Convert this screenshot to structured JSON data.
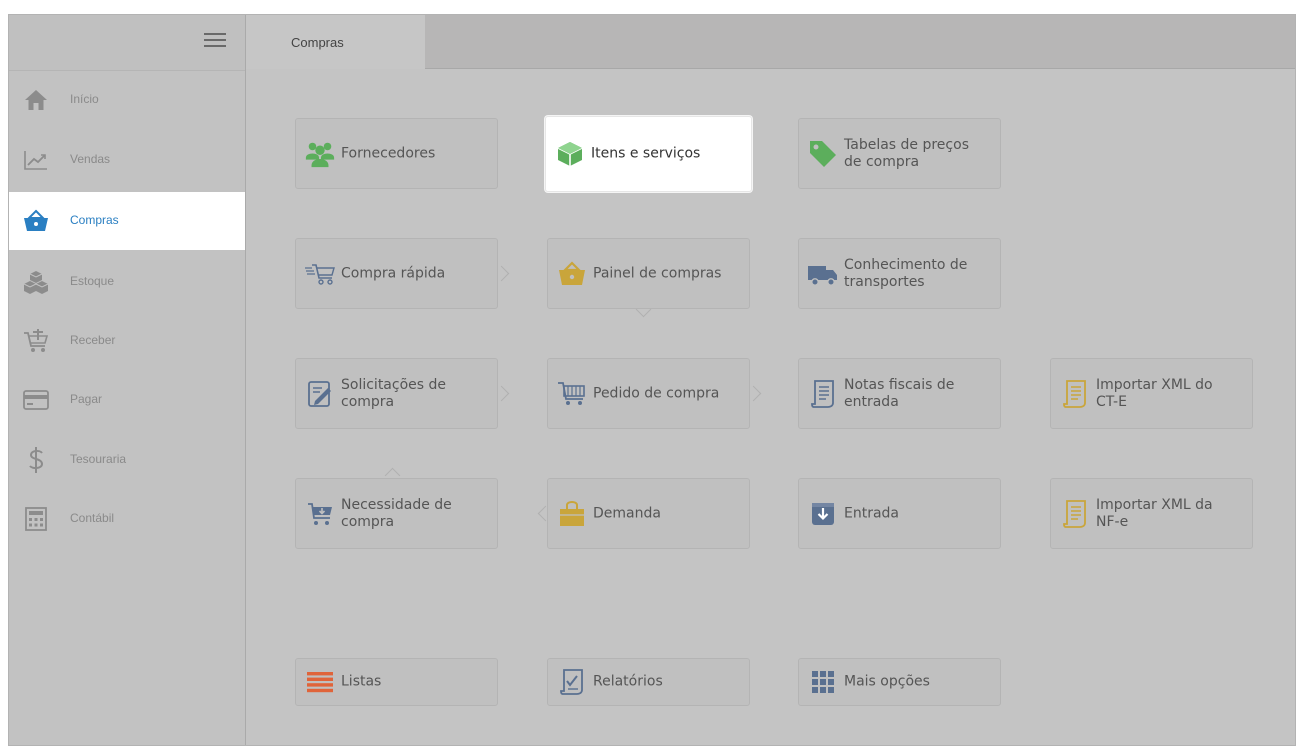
{
  "topbar": {
    "tab_label": "Compras"
  },
  "sidebar": {
    "items": [
      {
        "label": "Início",
        "icon": "home-icon"
      },
      {
        "label": "Vendas",
        "icon": "chart-line-icon"
      },
      {
        "label": "Compras",
        "icon": "basket-icon",
        "active": true
      },
      {
        "label": "Estoque",
        "icon": "boxes-icon"
      },
      {
        "label": "Receber",
        "icon": "cart-add-icon"
      },
      {
        "label": "Pagar",
        "icon": "credit-card-icon"
      },
      {
        "label": "Tesouraria",
        "icon": "dollar-icon"
      },
      {
        "label": "Contábil",
        "icon": "calculator-icon"
      }
    ]
  },
  "tiles": {
    "fornecedores": "Fornecedores",
    "itens_servicos": "Itens e serviços",
    "tabelas_precos": "Tabelas de preços\nde compra",
    "compra_rapida": "Compra rápida",
    "painel_compras": "Painel de compras",
    "conhecimento": "Conhecimento de\ntransportes",
    "solicitacoes": "Solicitações de\ncompra",
    "pedido_compra": "Pedido de compra",
    "notas_fiscais": "Notas fiscais de\nentrada",
    "importar_cte": "Importar XML do\nCT-E",
    "necessidade": "Necessidade de\ncompra",
    "demanda": "Demanda",
    "entrada": "Entrada",
    "importar_nfe": "Importar XML da\nNF-e",
    "listas": "Listas",
    "relatorios": "Relatórios",
    "mais_opcoes": "Mais opções"
  },
  "colors": {
    "active_blue": "#2a7fc2",
    "green": "#5cae5c",
    "gold": "#c9a53b",
    "slate_blue": "#5a7090",
    "orange": "#e0643a"
  }
}
